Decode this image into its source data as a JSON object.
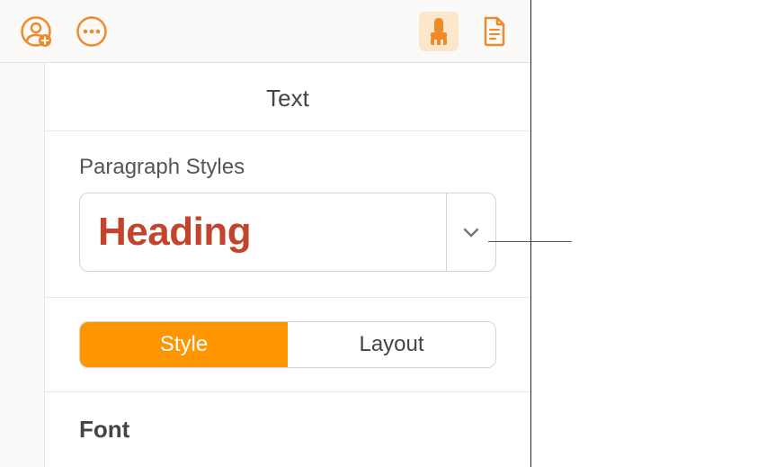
{
  "toolbar": {
    "collaborate_icon": "collaborate",
    "more_icon": "more",
    "format_icon": "format",
    "document_icon": "document"
  },
  "panel": {
    "title": "Text",
    "paragraph_styles": {
      "label": "Paragraph Styles",
      "selected": "Heading"
    },
    "tabs": {
      "style": "Style",
      "layout": "Layout"
    },
    "font": {
      "label": "Font"
    }
  }
}
